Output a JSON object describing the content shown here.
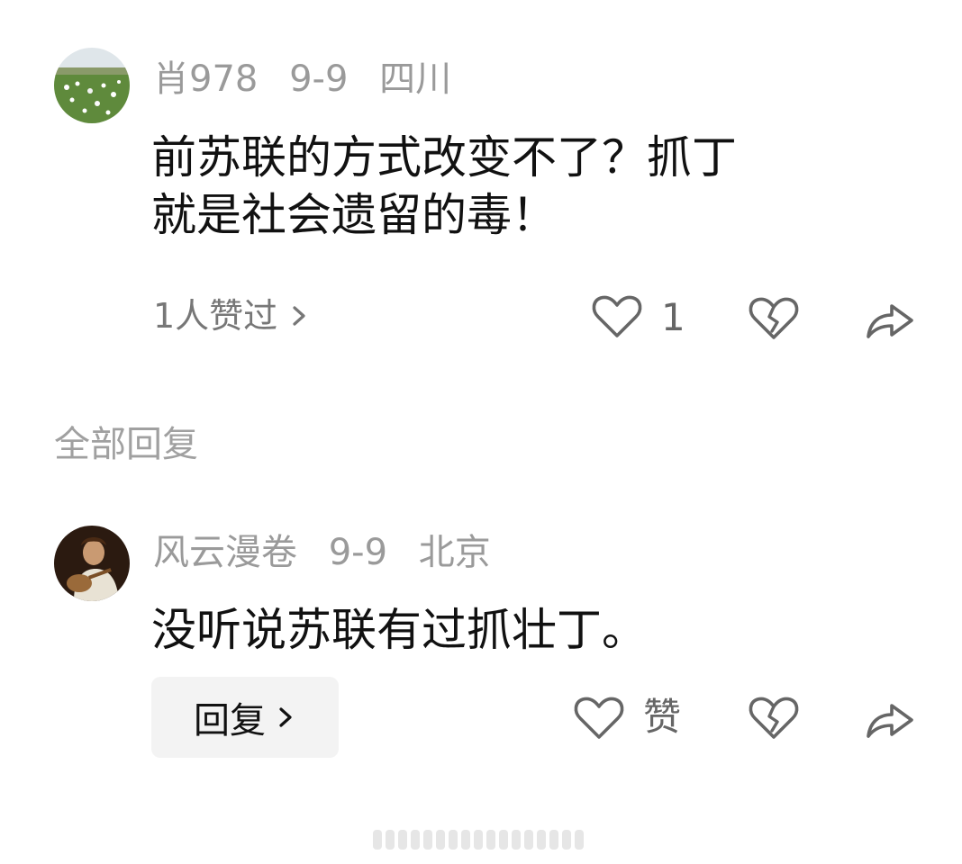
{
  "comments": [
    {
      "author": "肖978",
      "date": "9-9",
      "location": "四川",
      "text_lines": [
        "前苏联的方式改变不了？抓丁",
        "就是社会遗留的毒！"
      ],
      "likes_summary": "1人赞过",
      "like_count": "1",
      "avatar_icon": "landscape-avatar-icon"
    }
  ],
  "section_title": "全部回复",
  "replies": [
    {
      "author": "风云漫卷",
      "date": "9-9",
      "location": "北京",
      "text": "没听说苏联有过抓壮丁。",
      "reply_button": "回复",
      "like_label": "赞",
      "avatar_icon": "portrait-avatar-icon"
    }
  ],
  "icons": {
    "like": "heart-outline-icon",
    "dislike": "broken-heart-icon",
    "share": "share-arrow-icon",
    "chevron": "chevron-right-icon"
  },
  "colors": {
    "meta": "#9a9a9a",
    "text": "#111111",
    "icon": "#666666",
    "button_bg": "#f3f3f3"
  }
}
